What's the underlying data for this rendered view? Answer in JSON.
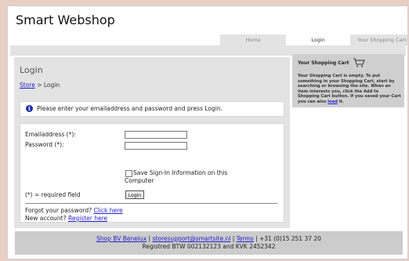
{
  "site": {
    "title": "Smart Webshop"
  },
  "tabs": [
    {
      "label": "Home"
    },
    {
      "label": "Login"
    },
    {
      "label": "Your Shopping Cart"
    }
  ],
  "page": {
    "heading": "Login",
    "breadcrumb": {
      "store": "Store",
      "separator": " > ",
      "current": "Login"
    },
    "notice": "Please enter your emailaddress and password and press Login."
  },
  "form": {
    "email_label": "Emailaddress (*):",
    "email_value": "",
    "password_label": "Password (*):",
    "password_value": "",
    "remember_label": "Save Sign-In Information on this Computer",
    "remember_checked": false,
    "required_note": "(*) = required field",
    "login_button": "Login",
    "forgot_text": "Forgot your password? ",
    "forgot_link": "Click here",
    "new_account_text": "New account? ",
    "register_link": "Register here"
  },
  "cart": {
    "title": "Your Shopping Cart",
    "text_before_link": "Your Shopping Cart is empty. To put something in your Shopping Cart, start by searching or browsing the site. When an item interests you, click the Add to Shopping Cart button. If you saved your Cart you can also ",
    "load_link": "load",
    "text_after_link": " it."
  },
  "footer": {
    "company_link": "Shop BV Benelux",
    "sep1": " | ",
    "email_link": "storesupport@smartsite.nl",
    "sep2": " | ",
    "terms_link": "Terms",
    "phone": " | +31 (0)15 251 37 20",
    "registration": "Registred BTW 002132123 and KVK 2452342"
  },
  "colors": {
    "background": "#e8cfc6",
    "panel": "#e3e3e3",
    "link": "#2222cc",
    "info_icon": "#1e2fa8",
    "footer": "#cccccc"
  },
  "icons": {
    "info": "info-icon",
    "cart": "shopping-cart-icon"
  }
}
